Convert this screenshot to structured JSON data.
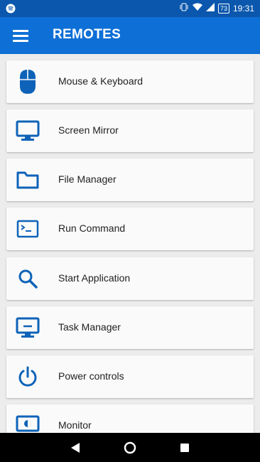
{
  "status_bar": {
    "time": "19:31",
    "battery": "73"
  },
  "app_bar": {
    "title": "REMOTES"
  },
  "colors": {
    "primary": "#0e6fd6",
    "status": "#0a57ad",
    "icon": "#0e63b8"
  },
  "remotes": [
    {
      "label": "Mouse & Keyboard",
      "icon": "mouse-icon"
    },
    {
      "label": "Screen Mirror",
      "icon": "monitor-icon"
    },
    {
      "label": "File Manager",
      "icon": "folder-icon"
    },
    {
      "label": "Run Command",
      "icon": "terminal-icon"
    },
    {
      "label": "Start Application",
      "icon": "search-icon"
    },
    {
      "label": "Task Manager",
      "icon": "task-manager-icon"
    },
    {
      "label": "Power controls",
      "icon": "power-icon"
    },
    {
      "label": "Monitor",
      "icon": "brightness-monitor-icon"
    }
  ]
}
